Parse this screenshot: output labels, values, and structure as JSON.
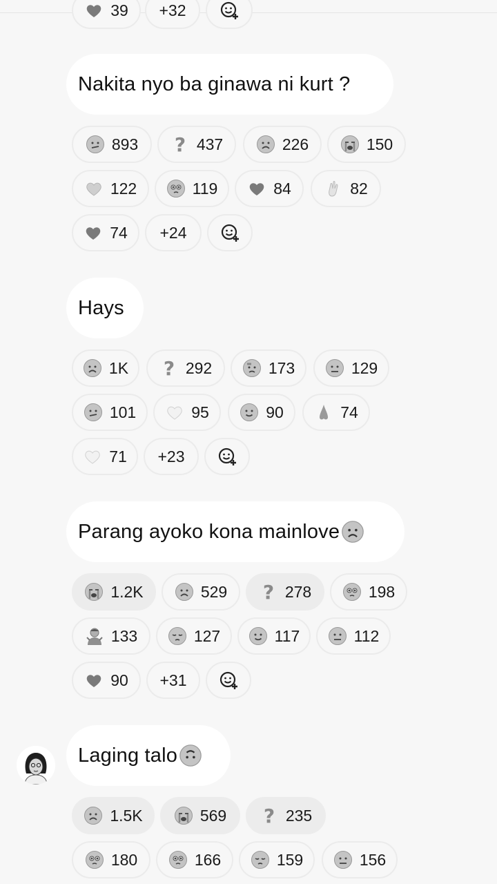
{
  "prev_reactions": [
    "39",
    "+32"
  ],
  "messages": [
    {
      "text": "Nakita nyo ba ginawa ni kurt ?",
      "reactions": [
        "893",
        "437",
        "226",
        "150",
        "122",
        "119",
        "84",
        "82",
        "74"
      ],
      "more": "+24"
    },
    {
      "text": "Hays",
      "reactions": [
        "1K",
        "292",
        "173",
        "129",
        "101",
        "95",
        "90",
        "74",
        "71"
      ],
      "more": "+23"
    },
    {
      "text": "Parang ayoko kona mainlove",
      "reactions": [
        "1.2K",
        "529",
        "278",
        "198",
        "133",
        "127",
        "117",
        "112",
        "90"
      ],
      "more": "+31"
    },
    {
      "text": "Laging talo",
      "reactions": [
        "1.5K",
        "569",
        "235",
        "180",
        "166",
        "159",
        "156"
      ]
    }
  ],
  "icons": {
    "confused": "confused-face-icon",
    "question": "question-mark-icon",
    "frown": "frowning-face-icon",
    "cry": "loudly-crying-face-icon",
    "heart": "heart-icon",
    "pleading": "pleading-face-icon",
    "ok": "ok-hand-icon",
    "sad_sweat": "sad-sweat-face-icon",
    "neutral": "neutral-face-icon",
    "slight_smile": "slightly-smiling-face-icon",
    "nose": "nose-icon",
    "pensive": "pensive-face-icon",
    "person_shrug": "person-gesture-icon",
    "upside_down": "upside-down-face-icon",
    "add_reaction": "add-reaction-icon"
  }
}
